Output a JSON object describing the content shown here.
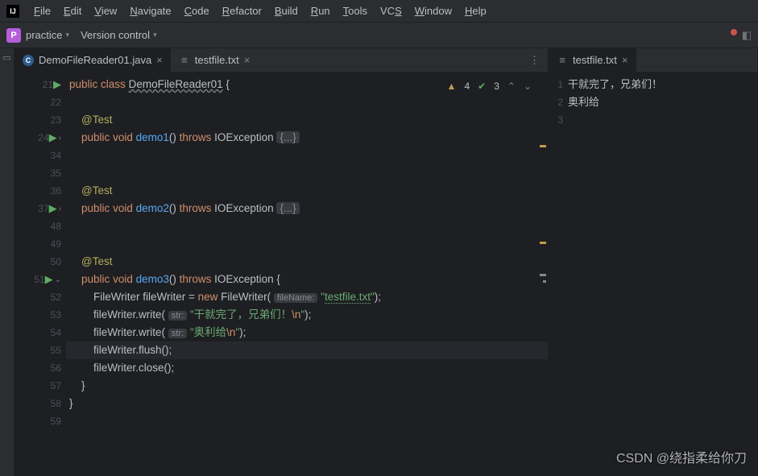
{
  "menu": {
    "items": [
      "File",
      "Edit",
      "View",
      "Navigate",
      "Code",
      "Refactor",
      "Build",
      "Run",
      "Tools",
      "VCS",
      "Window",
      "Help"
    ],
    "underline_idx": [
      0,
      0,
      0,
      0,
      0,
      0,
      0,
      0,
      0,
      2,
      0,
      0
    ]
  },
  "toolbar": {
    "project_initial": "P",
    "project": "practice",
    "vc": "Version control"
  },
  "tabs_left": [
    {
      "name": "DemoFileReader01.java",
      "type": "java",
      "active": true
    },
    {
      "name": "testfile.txt",
      "type": "txt",
      "active": false
    }
  ],
  "tabs_right": [
    {
      "name": "testfile.txt",
      "type": "txt",
      "active": true
    }
  ],
  "inspections": {
    "warn": "4",
    "ok": "3"
  },
  "code": {
    "lines": [
      {
        "n": "21",
        "run": true,
        "html": "<span class='kw'>public</span> <span class='kw'>class</span> <span class='cls underline'>DemoFileReader01</span> {"
      },
      {
        "n": "22",
        "html": ""
      },
      {
        "n": "23",
        "html": "    <span class='ann'>@Test</span>"
      },
      {
        "n": "24",
        "run": true,
        "fold": ">",
        "html": "    <span class='kw'>public</span> <span class='kw'>void</span> <span class='mtd'>demo1</span>() <span class='kw'>throws</span> IOException <span class='fold-box'>{...}</span>"
      },
      {
        "n": "34",
        "html": ""
      },
      {
        "n": "35",
        "html": ""
      },
      {
        "n": "36",
        "html": "    <span class='ann'>@Test</span>"
      },
      {
        "n": "37",
        "run": true,
        "fold": ">",
        "html": "    <span class='kw'>public</span> <span class='kw'>void</span> <span class='mtd'>demo2</span>() <span class='kw'>throws</span> IOException <span class='fold-box'>{...}</span>"
      },
      {
        "n": "48",
        "html": ""
      },
      {
        "n": "49",
        "html": ""
      },
      {
        "n": "50",
        "html": "    <span class='ann'>@Test</span>"
      },
      {
        "n": "51",
        "run": true,
        "fold": "v",
        "html": "    <span class='kw'>public</span> <span class='kw'>void</span> <span class='mtd'>demo3</span>() <span class='kw'>throws</span> IOException {"
      },
      {
        "n": "52",
        "html": "        FileWriter fileWriter = <span class='kw'>new</span> FileWriter( <span class='param'>fileName:</span> <span class='str'>\"<span class='str-u'>testfile.txt</span>\"</span>);"
      },
      {
        "n": "53",
        "html": "        fileWriter.write( <span class='param'>str:</span> <span class='str'>\"干就完了，兄弟们！<span class='esc'>\\n</span>\"</span>);"
      },
      {
        "n": "54",
        "html": "        fileWriter.write( <span class='param'>str:</span> <span class='str'>\"奥利给<span class='esc'>\\n</span>\"</span>);"
      },
      {
        "n": "55",
        "hl": true,
        "html": "        fileWriter.flush();"
      },
      {
        "n": "56",
        "html": "        fileWriter.close();"
      },
      {
        "n": "57",
        "html": "    }"
      },
      {
        "n": "58",
        "html": "}"
      },
      {
        "n": "59",
        "html": ""
      }
    ]
  },
  "textfile": {
    "lines": [
      {
        "n": "1",
        "t": "干就完了，兄弟们！"
      },
      {
        "n": "2",
        "t": "奥利给"
      },
      {
        "n": "3",
        "t": ""
      }
    ]
  },
  "watermark": "CSDN @绕指柔给你刀"
}
